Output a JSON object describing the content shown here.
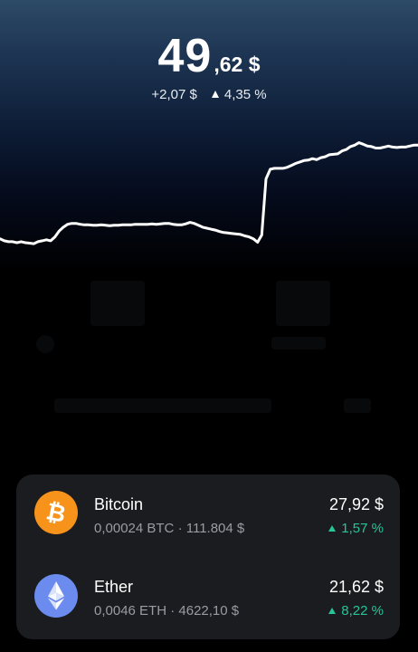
{
  "portfolio": {
    "balance_int": "49",
    "balance_dec": ",62 $",
    "change_abs": "+2,07 $",
    "change_pct": "4,35 %"
  },
  "chart_data": {
    "type": "line",
    "title": "",
    "xlabel": "",
    "ylabel": "",
    "grid": false,
    "series": [
      {
        "color": "#ffffff",
        "values": [
          47.68,
          47.64,
          47.62,
          47.62,
          47.6,
          47.62,
          47.6,
          47.59,
          47.58,
          47.62,
          47.64,
          47.66,
          47.64,
          47.72,
          47.84,
          47.92,
          47.98,
          48.0,
          48.0,
          47.98,
          47.97,
          47.97,
          47.96,
          47.96,
          47.97,
          47.96,
          47.95,
          47.96,
          47.96,
          47.97,
          47.97,
          47.97,
          47.98,
          47.98,
          47.98,
          47.98,
          47.99,
          47.98,
          47.99,
          48.0,
          48.0,
          47.98,
          47.97,
          47.97,
          47.99,
          48.02,
          48.0,
          47.96,
          47.92,
          47.9,
          47.88,
          47.86,
          47.83,
          47.81,
          47.8,
          47.79,
          47.78,
          47.77,
          47.74,
          47.72,
          47.68,
          47.61,
          47.76,
          48.92,
          49.12,
          49.14,
          49.14,
          49.14,
          49.16,
          49.2,
          49.24,
          49.27,
          49.3,
          49.31,
          49.34,
          49.32,
          49.36,
          49.38,
          49.42,
          49.43,
          49.44,
          49.5,
          49.53,
          49.59,
          49.62,
          49.67,
          49.64,
          49.6,
          49.59,
          49.56,
          49.56,
          49.58,
          49.6,
          49.58,
          49.57,
          49.58,
          49.58,
          49.6,
          49.62,
          49.62
        ]
      }
    ],
    "ylim": [
      47.0,
      50.0
    ]
  },
  "assets": [
    {
      "name": "Bitcoin",
      "holding": "0,00024 BTC",
      "separator": "·",
      "price": "111.804 $",
      "value": "27,92 $",
      "change": "1,57 %",
      "icon": "bitcoin-icon",
      "icon_color": "#f7931a"
    },
    {
      "name": "Ether",
      "holding": "0,0046 ETH",
      "separator": "·",
      "price": "4622,10 $",
      "value": "21,62 $",
      "change": "8,22 %",
      "icon": "ethereum-icon",
      "icon_color": "#6b8cee"
    }
  ],
  "colors": {
    "accent_green": "#26c59a",
    "card_bg": "#1b1c1f",
    "muted_text": "#9a9ca3"
  }
}
